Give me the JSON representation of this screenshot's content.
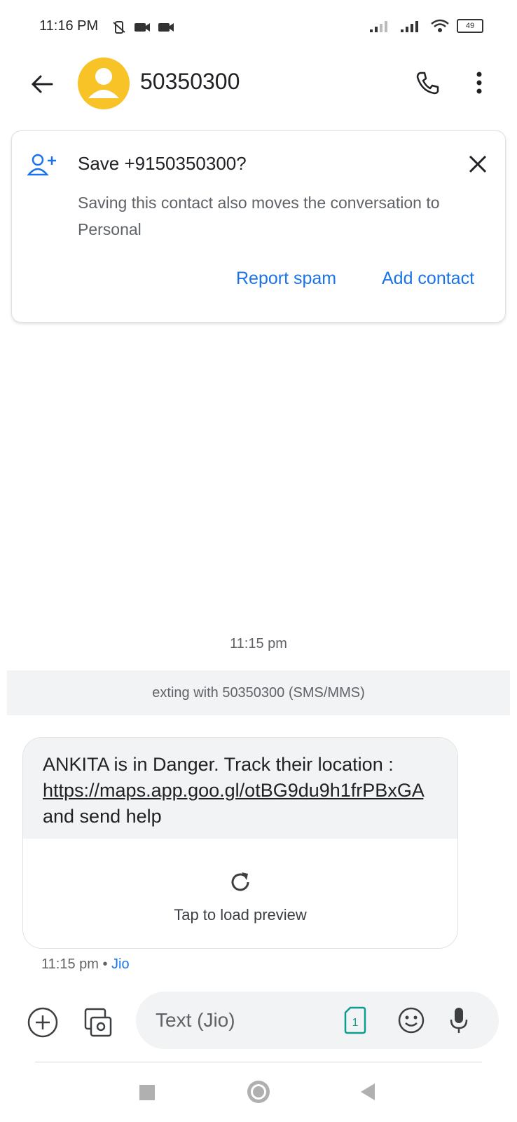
{
  "status_bar": {
    "time": "11:16 PM",
    "battery": "49"
  },
  "header": {
    "title": "50350300",
    "icons": [
      "back-arrow-icon",
      "person-icon",
      "phone-icon",
      "more-vert-icon"
    ]
  },
  "banner": {
    "title": "Save +9150350300?",
    "body": "Saving this contact also moves the conversation to Personal",
    "report_spam_label": "Report spam",
    "add_contact_label": "Add contact"
  },
  "conversation": {
    "timestamp": "11:15 pm",
    "sms_notice": "exting with 50350300 (SMS/MMS)",
    "message": {
      "text_before": "ANKITA is in Danger. Track their location : ",
      "link": "https://maps.app.goo.gl/otBG9du9h1frPBxGA",
      "text_after": " and send help",
      "preview_label": "Tap to load preview",
      "time": "11:15 pm",
      "separator": " • ",
      "carrier": "Jio"
    }
  },
  "compose": {
    "placeholder": "Text (Jio)",
    "sim_number": "1"
  },
  "colors": {
    "accent": "#1a73e8",
    "avatar": "#f7c327",
    "bubble": "#f1f3f4"
  }
}
